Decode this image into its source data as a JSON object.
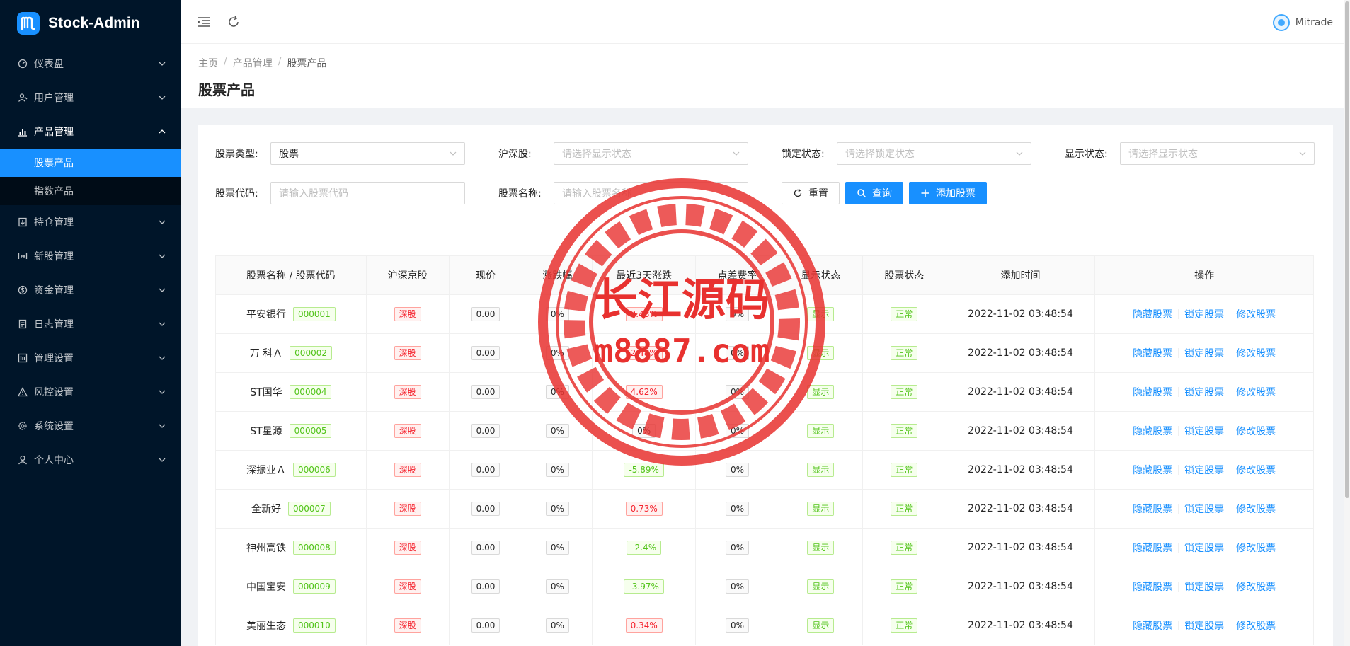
{
  "app": {
    "title": "Stock-Admin"
  },
  "sidebar": {
    "items": [
      {
        "label": "仪表盘",
        "icon": "dashboard-icon"
      },
      {
        "label": "用户管理",
        "icon": "user-manage-icon"
      },
      {
        "label": "产品管理",
        "icon": "bar-chart-icon",
        "open": true,
        "children": [
          {
            "label": "股票产品",
            "active": true
          },
          {
            "label": "指数产品"
          }
        ]
      },
      {
        "label": "持仓管理",
        "icon": "position-icon"
      },
      {
        "label": "新股管理",
        "icon": "new-stock-icon"
      },
      {
        "label": "资金管理",
        "icon": "money-icon"
      },
      {
        "label": "日志管理",
        "icon": "log-icon"
      },
      {
        "label": "管理设置",
        "icon": "manage-settings-icon"
      },
      {
        "label": "风控设置",
        "icon": "warning-icon"
      },
      {
        "label": "系统设置",
        "icon": "gear-icon"
      },
      {
        "label": "个人中心",
        "icon": "person-icon"
      }
    ]
  },
  "header": {
    "user_name": "Mitrade"
  },
  "breadcrumb": {
    "home": "主页",
    "parent": "产品管理",
    "current": "股票产品"
  },
  "page": {
    "title": "股票产品"
  },
  "filters": {
    "stock_type": {
      "label": "股票类型:",
      "value": "股票"
    },
    "hs": {
      "label": "沪深股:",
      "placeholder": "请选择显示状态"
    },
    "lock": {
      "label": "锁定状态:",
      "placeholder": "请选择锁定状态"
    },
    "show": {
      "label": "显示状态:",
      "placeholder": "请选择显示状态"
    },
    "code": {
      "label": "股票代码:",
      "placeholder": "请输入股票代码"
    },
    "name": {
      "label": "股票名称:",
      "placeholder": "请输入股票名称"
    },
    "reset_label": "重置",
    "query_label": "查询",
    "add_label": "添加股票"
  },
  "table": {
    "headers": [
      "股票名称 / 股票代码",
      "沪深京股",
      "现价",
      "涨跌幅",
      "最近3天涨跌",
      "点差费率",
      "显示状态",
      "股票状态",
      "添加时间",
      "操作"
    ],
    "actions": [
      "隐藏股票",
      "锁定股票",
      "修改股票"
    ],
    "rows": [
      {
        "name": "平安银行",
        "code": "000001",
        "market": "深股",
        "price": "0.00",
        "change": "0%",
        "change3": "2.48%",
        "up": true,
        "fee": "0%",
        "show": "显示",
        "status": "正常",
        "time": "2022-11-02 03:48:54"
      },
      {
        "name": "万 科Ａ",
        "code": "000002",
        "market": "深股",
        "price": "0.00",
        "change": "0%",
        "change3": "2.48%",
        "up": true,
        "fee": "0%",
        "show": "显示",
        "status": "正常",
        "time": "2022-11-02 03:48:54"
      },
      {
        "name": "ST国华",
        "code": "000004",
        "market": "深股",
        "price": "0.00",
        "change": "0%",
        "change3": "4.62%",
        "up": true,
        "fee": "0%",
        "show": "显示",
        "status": "正常",
        "time": "2022-11-02 03:48:54"
      },
      {
        "name": "ST星源",
        "code": "000005",
        "market": "深股",
        "price": "0.00",
        "change": "0%",
        "change3": "0%",
        "neutral": true,
        "fee": "0%",
        "show": "显示",
        "status": "正常",
        "time": "2022-11-02 03:48:54"
      },
      {
        "name": "深振业Ａ",
        "code": "000006",
        "market": "深股",
        "price": "0.00",
        "change": "0%",
        "change3": "-5.89%",
        "up": false,
        "fee": "0%",
        "show": "显示",
        "status": "正常",
        "time": "2022-11-02 03:48:54"
      },
      {
        "name": "全新好",
        "code": "000007",
        "market": "深股",
        "price": "0.00",
        "change": "0%",
        "change3": "0.73%",
        "up": true,
        "fee": "0%",
        "show": "显示",
        "status": "正常",
        "time": "2022-11-02 03:48:54"
      },
      {
        "name": "神州高铁",
        "code": "000008",
        "market": "深股",
        "price": "0.00",
        "change": "0%",
        "change3": "-2.4%",
        "up": false,
        "fee": "0%",
        "show": "显示",
        "status": "正常",
        "time": "2022-11-02 03:48:54"
      },
      {
        "name": "中国宝安",
        "code": "000009",
        "market": "深股",
        "price": "0.00",
        "change": "0%",
        "change3": "-3.97%",
        "up": false,
        "fee": "0%",
        "show": "显示",
        "status": "正常",
        "time": "2022-11-02 03:48:54"
      },
      {
        "name": "美丽生态",
        "code": "000010",
        "market": "深股",
        "price": "0.00",
        "change": "0%",
        "change3": "0.34%",
        "up": true,
        "fee": "0%",
        "show": "显示",
        "status": "正常",
        "time": "2022-11-02 03:48:54"
      }
    ]
  },
  "watermark": {
    "line1": "长江源码",
    "line2": "m8887.com"
  },
  "colors": {
    "primary": "#1890ff",
    "sidebar_bg": "#001529",
    "up": "#f5222d",
    "down": "#52c41a",
    "watermark": "#e8312f"
  }
}
